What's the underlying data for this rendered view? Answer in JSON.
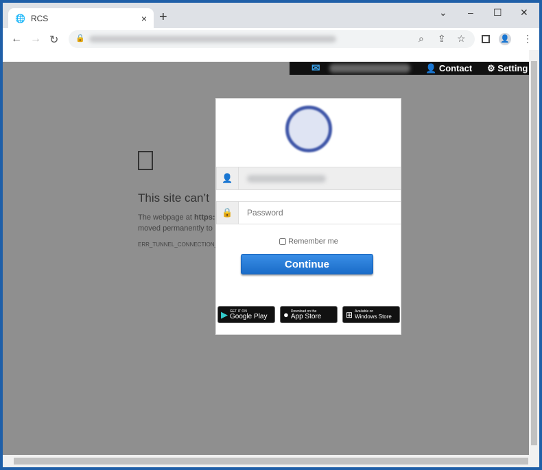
{
  "browser": {
    "tab_title": "RCS",
    "tab_close": "×",
    "new_tab": "+",
    "window_controls": {
      "dropdown": "⌄",
      "minimize": "–",
      "maximize": "☐",
      "close": "✕"
    },
    "nav": {
      "back": "←",
      "forward": "→",
      "reload": "↻"
    }
  },
  "topbar": {
    "contact": "Contact",
    "settings": "Setting"
  },
  "error_page": {
    "title": "This site can’t",
    "line1_prefix": "The webpage at ",
    "line1_bold": "https:",
    "line2": "moved permanently to",
    "code": "ERR_TUNNEL_CONNECTION_"
  },
  "login": {
    "password_placeholder": "Password",
    "remember_label": "Remember me",
    "continue_label": "Continue",
    "badges": [
      {
        "small": "GET IT ON",
        "large": "Google Play"
      },
      {
        "small": "Download on the",
        "large": "App Store"
      },
      {
        "small": "Available on",
        "large": "Windows Store"
      }
    ]
  },
  "colors": {
    "accent": "#1a6cc8",
    "frame": "#1f5fa8",
    "overlay": "#8f8f8f"
  }
}
